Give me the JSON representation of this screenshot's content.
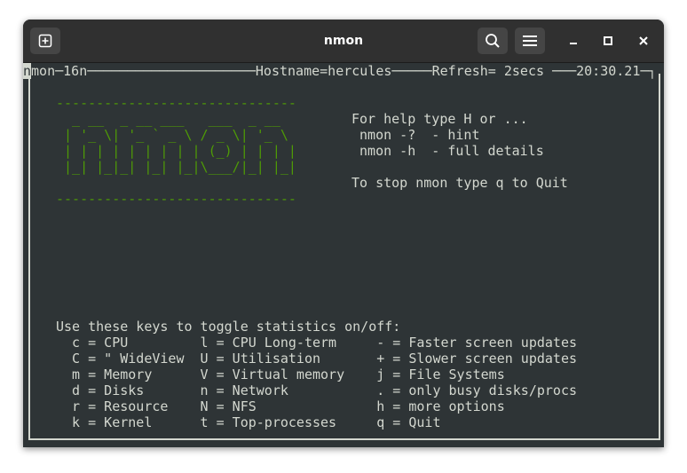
{
  "window": {
    "title": "nmon"
  },
  "terminal": {
    "header": "nmon─16n─────────────────────Hostname=hercules─────Refresh= 2secs ───20:30.21─┐",
    "header_cursor": "n",
    "header_rest": "mon─16n─────────────────────Hostname=hercules─────Refresh= 2secs ───20:30.21─┐",
    "logo": [
      "------------------------------",
      "  _ __  _ __ ___   ___  _ __  ",
      " | '_ \\| '_ ` _ \\ / _ \\| '_ \\ ",
      " | | | | | | | | | (_) | | | |",
      " |_| |_|_| |_| |_|\\___/|_| |_|",
      "",
      "------------------------------"
    ],
    "help": [
      "For help type H or ...",
      " nmon -?  - hint",
      " nmon -h  - full details",
      "",
      "To stop nmon type q to Quit"
    ],
    "keys_title": "Use these keys to toggle statistics on/off:",
    "keys": [
      "  c = CPU         l = CPU Long-term     - = Faster screen updates",
      "  C = \" WideView  U = Utilisation       + = Slower screen updates",
      "  m = Memory      V = Virtual memory    j = File Systems",
      "  d = Disks       n = Network           . = only busy disks/procs",
      "  r = Resource    N = NFS               h = more options",
      "  k = Kernel      t = Top-processes     q = Quit"
    ]
  }
}
